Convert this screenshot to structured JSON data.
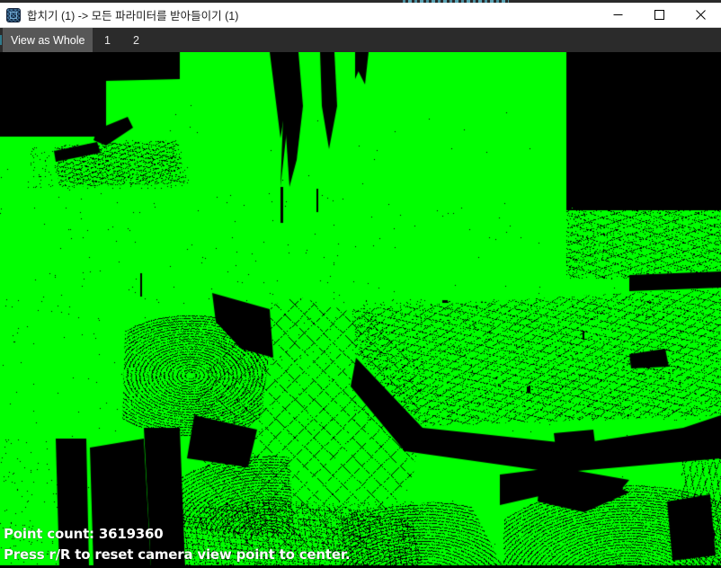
{
  "window": {
    "title": "합치기 (1) -> 모든 파라미터를 받아들이기 (1)",
    "icon": "point-cloud-app-icon",
    "controls": {
      "minimize": "minimize-icon",
      "maximize": "maximize-icon",
      "close": "close-icon"
    }
  },
  "tabs": [
    {
      "label": "View as Whole",
      "selected": true
    },
    {
      "label": "1",
      "selected": false
    },
    {
      "label": "2",
      "selected": false
    }
  ],
  "viewport": {
    "point_color": "#00FF00",
    "background_color": "#000000",
    "hud": {
      "point_count_label": "Point count: 3619360",
      "reset_hint": "Press r/R to reset camera view point to center."
    }
  },
  "measures": {
    "point_count": 3619360
  }
}
